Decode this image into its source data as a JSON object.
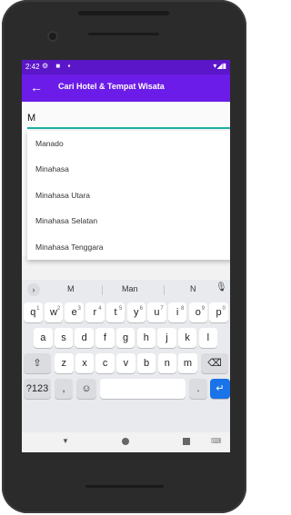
{
  "status": {
    "time": "2:42",
    "left_icons": "⚙ ■ ▪",
    "right_icons": "▾◢▮"
  },
  "appbar": {
    "title": "Cari Hotel & Tempat Wisata"
  },
  "search": {
    "value": "M"
  },
  "dropdown": {
    "items": [
      "Manado",
      "Minahasa",
      "Minahasa Utara",
      "Minahasa Selatan",
      "Minahasa Tenggara"
    ]
  },
  "keyboard": {
    "suggestions": [
      "M",
      "Man",
      "N"
    ],
    "row1": [
      {
        "k": "q",
        "n": "1"
      },
      {
        "k": "w",
        "n": "2"
      },
      {
        "k": "e",
        "n": "3"
      },
      {
        "k": "r",
        "n": "4"
      },
      {
        "k": "t",
        "n": "5"
      },
      {
        "k": "y",
        "n": "6"
      },
      {
        "k": "u",
        "n": "7"
      },
      {
        "k": "i",
        "n": "8"
      },
      {
        "k": "o",
        "n": "9"
      },
      {
        "k": "p",
        "n": "0"
      }
    ],
    "row2": [
      "a",
      "s",
      "d",
      "f",
      "g",
      "h",
      "j",
      "k",
      "l"
    ],
    "row3": [
      "z",
      "x",
      "c",
      "v",
      "b",
      "n",
      "m"
    ],
    "symbols_label": "?123",
    "comma": ",",
    "period": "."
  },
  "colors": {
    "statusbar": "#5b16c9",
    "appbar": "#6c1ce8",
    "accent_underline": "#1db0a4",
    "enter_key": "#1a73e8"
  }
}
